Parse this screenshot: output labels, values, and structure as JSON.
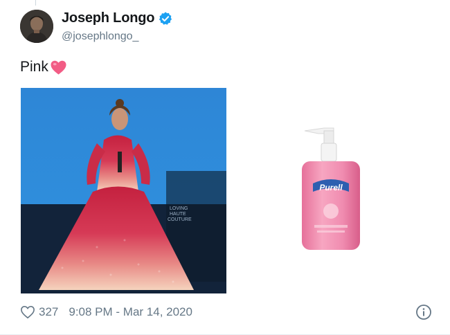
{
  "author": {
    "display_name": "Joseph Longo",
    "handle": "@josephlongo_",
    "verified": true
  },
  "tweet": {
    "text": "Pink",
    "emoji": "pink-heart"
  },
  "media": [
    {
      "description_icon": "photo",
      "watermark": "LOVING HAUTE COUTURE"
    },
    {
      "description_icon": "photo",
      "brand_text": "Purell"
    }
  ],
  "footer": {
    "like_count": "327",
    "timestamp": "9:08 PM - Mar 14, 2020"
  },
  "colors": {
    "text_primary": "#14171a",
    "text_secondary": "#657786",
    "verified_blue": "#1da1f2",
    "heart_pink": "#e0245e"
  }
}
